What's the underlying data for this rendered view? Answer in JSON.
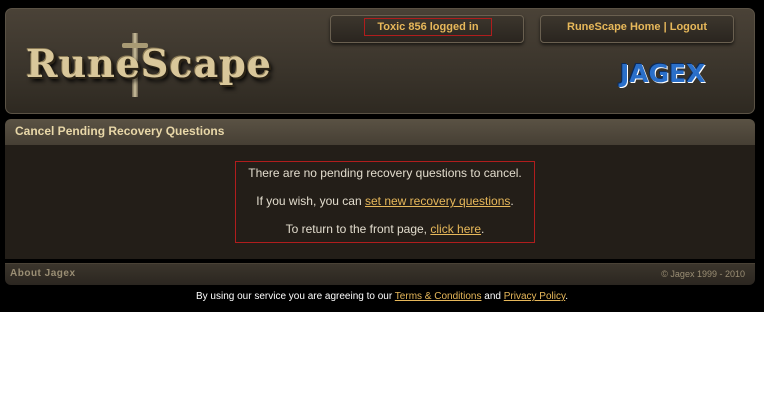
{
  "header": {
    "logged_in_text": "Toxic 856 logged in",
    "home_link": "RuneScape Home",
    "separator": "|",
    "logout_link": "Logout",
    "logo_text": "RuneScape",
    "jagex_logo_text": "JAGEX"
  },
  "page": {
    "title": "Cancel Pending Recovery Questions"
  },
  "message": {
    "line1": "There are no pending recovery questions to cancel.",
    "line2_prefix": "If you wish, you can ",
    "line2_link": "set new recovery questions",
    "line2_suffix": ".",
    "line3_prefix": "To return to the front page, ",
    "line3_link": "click here",
    "line3_suffix": "."
  },
  "footer": {
    "about_link": "About Jagex",
    "copyright": "© Jagex 1999 - 2010",
    "terms_prefix": "By using our service you are agreeing to our ",
    "terms_link": "Terms & Conditions",
    "terms_and": " and ",
    "privacy_link": "Privacy Policy",
    "terms_suffix": "."
  },
  "colors": {
    "accent_gold": "#e7b85a",
    "border_red": "#b01d1d",
    "background": "#000000",
    "panel": "#231e18"
  },
  "icons": [
    "runescape-logo",
    "sword-icon",
    "jagex-logo"
  ]
}
